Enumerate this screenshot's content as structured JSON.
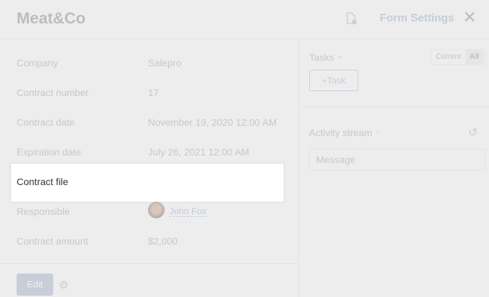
{
  "header": {
    "title": "Meat&Co",
    "form_settings": "Form Settings"
  },
  "fields": [
    {
      "label": "Company",
      "value": "Salepro"
    },
    {
      "label": "Contract number",
      "value": "17"
    },
    {
      "label": "Contract date",
      "value": "November 19, 2020 12:00 AM"
    },
    {
      "label": "Expiration date",
      "value": "July 26, 2021 12:00 AM"
    },
    {
      "label": "Contract file",
      "value": ""
    },
    {
      "label": "Responsible",
      "value": "John Fox"
    },
    {
      "label": "Contract amount",
      "value": "$2,000"
    }
  ],
  "footer": {
    "edit": "Edit"
  },
  "tasks": {
    "title": "Tasks",
    "toggle": [
      "Current",
      "All"
    ],
    "add": "+Task"
  },
  "activity": {
    "title": "Activity stream",
    "placeholder": "Message"
  }
}
